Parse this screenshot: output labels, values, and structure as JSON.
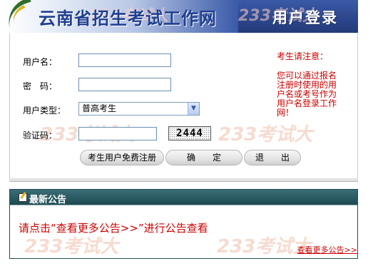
{
  "header": {
    "site_title": "云南省招生考试工作网",
    "login_title": "用户登录"
  },
  "watermark": "233考试大",
  "form": {
    "username_label": "用户名：",
    "username_value": "",
    "password_label": "密　码：",
    "password_value": "",
    "user_type_label": "用户类型：",
    "user_type_selected": "普高考生",
    "captcha_label": "验证码：",
    "captcha_value": "",
    "captcha_image_text": "2444"
  },
  "buttons": {
    "register": "考生用户免费注册",
    "confirm": "确　　定",
    "exit": "退　　出"
  },
  "notice": {
    "heading": "考生请注意：",
    "body": "您可以通过报名注册时使用的用户名或考号作为用户名登录工作网！"
  },
  "announcement": {
    "title": "最新公告",
    "message": "请点击“查看更多公告>>”进行公告查看",
    "more_link": "查看更多公告>>"
  },
  "colors": {
    "banner_blue": "#2d478d",
    "notice_red": "#cc0000",
    "announcement_header": "#1d4a52"
  }
}
